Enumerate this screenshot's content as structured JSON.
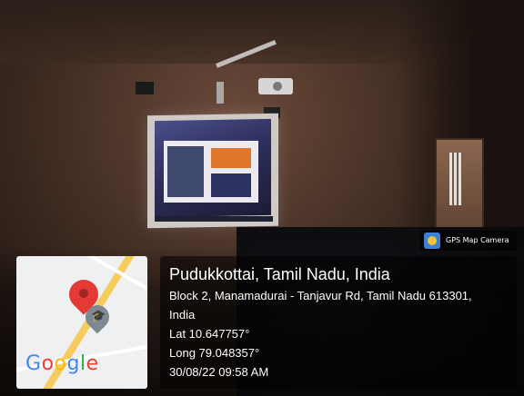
{
  "brand": {
    "camera_app_label": "GPS Map Camera",
    "map_logo": "Google"
  },
  "location": {
    "title": "Pudukkottai, Tamil Nadu, India",
    "address_line1": "Block 2, Manamadurai - Tanjavur Rd, Tamil Nadu 613301,",
    "address_line2": "India",
    "lat": "Lat 10.647757°",
    "long": "Long 79.048357°",
    "timestamp": "30/08/22 09:58 AM"
  },
  "icons": [
    "map-pin-icon",
    "graduation-cap-icon",
    "gps-camera-app-icon"
  ],
  "colors": {
    "pin": "#e53935",
    "road": "#f6cc5c",
    "overlay": "rgba(0,0,0,0.55)"
  }
}
